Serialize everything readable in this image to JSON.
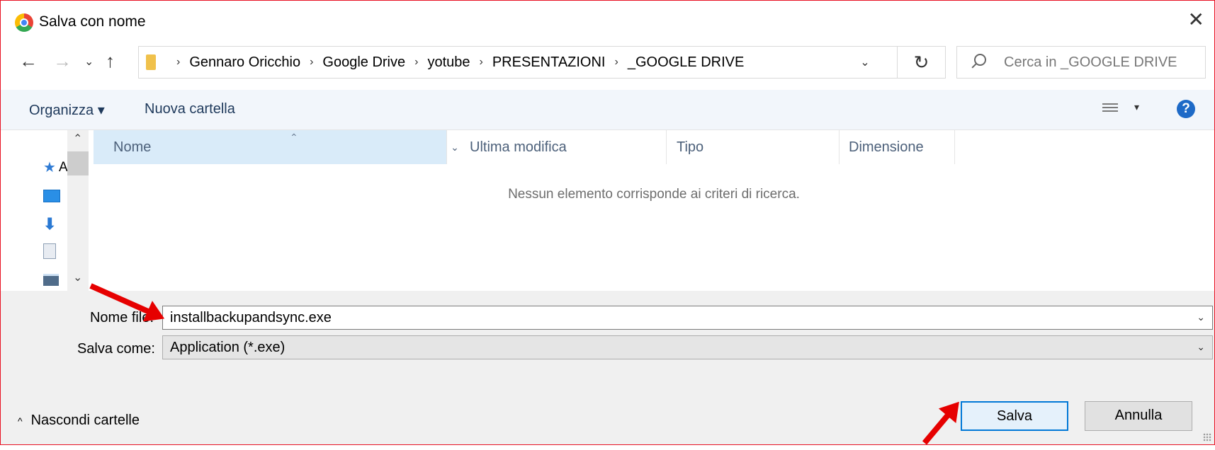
{
  "window": {
    "title": "Salva con nome",
    "close_glyph": "✕"
  },
  "nav": {
    "back_glyph": "←",
    "forward_glyph": "→",
    "recent_glyph": "⌄",
    "up_glyph": "↑",
    "breadcrumb": [
      "Gennaro Oricchio",
      "Google Drive",
      "yotube",
      "PRESENTAZIONI",
      "_GOOGLE DRIVE"
    ],
    "separator": "›",
    "dropdown_glyph": "⌄",
    "refresh_glyph": "↻"
  },
  "search": {
    "placeholder": "Cerca in _GOOGLE DRIVE"
  },
  "toolbar": {
    "organize_label": "Organizza ▾",
    "new_folder_label": "Nuova cartella",
    "view_dropdown_glyph": "▾",
    "help_glyph": "?"
  },
  "navpane": {
    "partial_label": "A",
    "up_glyph": "⌃",
    "down_glyph": "⌄",
    "star_glyph": "★",
    "download_glyph": "⬇"
  },
  "list": {
    "columns": [
      "Nome",
      "Ultima modifica",
      "Tipo",
      "Dimensione"
    ],
    "sort_glyph": "⌃",
    "col_drop_glyph": "⌄",
    "empty_message": "Nessun elemento corrisponde ai criteri di ricerca."
  },
  "form": {
    "filename_label": "Nome file:",
    "filename_value": "installbackupandsync.exe",
    "saveas_label": "Salva come:",
    "saveas_value": "Application (*.exe)",
    "dropdown_glyph": "⌄"
  },
  "footer": {
    "hide_folders_caret": "^",
    "hide_folders_label": "Nascondi cartelle",
    "save_label": "Salva",
    "cancel_label": "Annulla"
  },
  "colors": {
    "annotation_arrow": "#e60000",
    "primary_border": "#0078d7",
    "dialog_border": "#e81123"
  }
}
